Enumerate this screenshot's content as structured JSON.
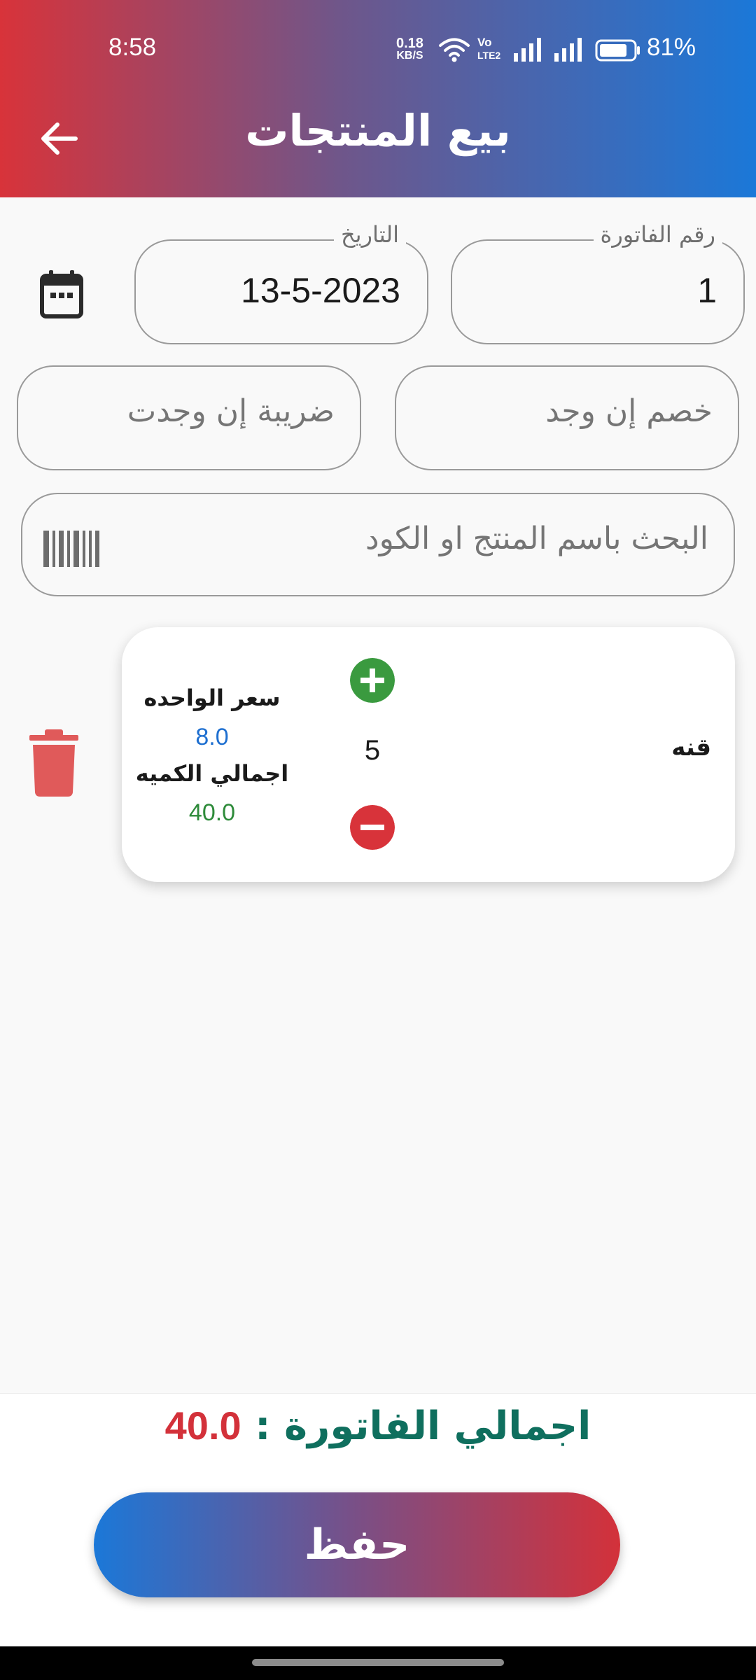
{
  "status_bar": {
    "time": "8:58",
    "net_speed_value": "0.18",
    "net_speed_unit": "KB/S",
    "volte_top": "Vo",
    "volte_bottom": "LTE2",
    "battery": "81%"
  },
  "app_bar": {
    "title": "بيع المنتجات",
    "back_icon": "arrow-left-icon",
    "gradient": [
      "#d8333a",
      "#1b78d8"
    ]
  },
  "form": {
    "invoice_number": {
      "label": "رقم الفاتورة",
      "value": "1"
    },
    "date": {
      "label": "التاريخ",
      "value": "13-5-2023"
    },
    "discount": {
      "placeholder": "خصم إن وجد"
    },
    "tax": {
      "placeholder": "ضريبة إن وجدت"
    },
    "search": {
      "placeholder": "البحث باسم المنتج او الكود"
    }
  },
  "cart_items": [
    {
      "name": "قنه",
      "quantity": "5",
      "unit_price_label": "سعر الواحده",
      "unit_price": "8.0",
      "total_label": "اجمالي الكميه",
      "total": "40.0"
    }
  ],
  "footer": {
    "total_label": "اجمالي الفاتورة :",
    "total_value": "40.0",
    "save_label": "حفظ"
  },
  "colors": {
    "total_label": "#0f6f5e",
    "total_value": "#d3313a",
    "unit_price": "#1e6fd0",
    "line_total": "#2e8b3a",
    "plus_button": "#3a9a3f",
    "minus_button": "#d8333a",
    "trash": "#e05a5a"
  }
}
